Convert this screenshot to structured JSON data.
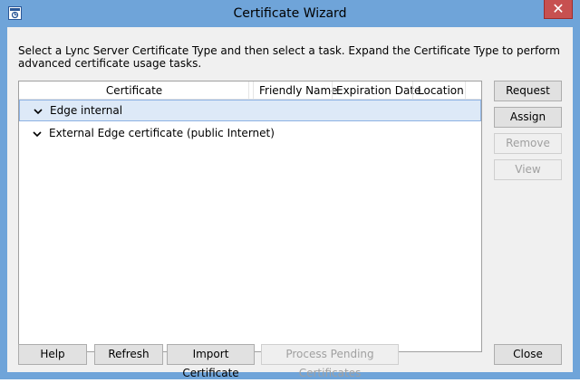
{
  "window": {
    "title": "Certificate Wizard",
    "close_glyph": "✕",
    "icon": "certificate-wizard-icon"
  },
  "instructions": "Select a Lync Server Certificate Type and then select a task. Expand the Certificate Type to perform advanced certificate usage tasks.",
  "list": {
    "columns": [
      "Certificate",
      "Friendly Name",
      "Expiration Date",
      "Location"
    ],
    "rows": [
      {
        "label": "Edge internal",
        "selected": true,
        "icon": "chevron-down-icon"
      },
      {
        "label": "External Edge certificate (public Internet)",
        "selected": false,
        "icon": "chevron-down-icon"
      }
    ]
  },
  "side_buttons": {
    "request": "Request",
    "assign": "Assign",
    "remove": "Remove",
    "view": "View"
  },
  "bottom_buttons": {
    "help": "Help",
    "refresh": "Refresh",
    "import": "Import Certificate",
    "process_pending": "Process Pending Certificates",
    "close": "Close"
  },
  "colors": {
    "frame": "#6fa4d9",
    "selection": "#dde9f7",
    "close_button": "#c75050"
  }
}
